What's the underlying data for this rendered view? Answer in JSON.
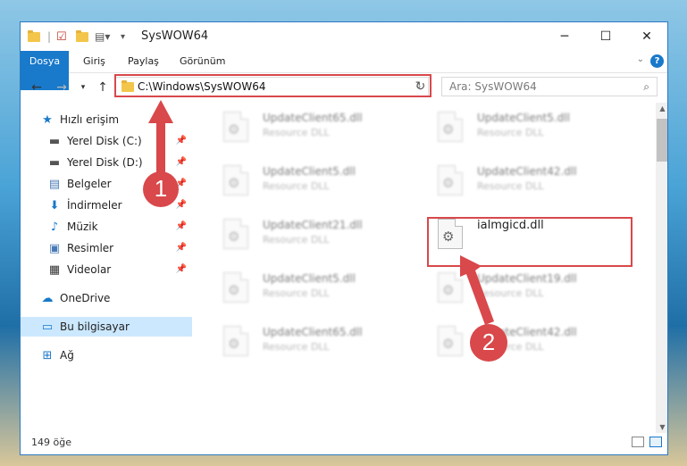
{
  "window": {
    "title": "SysWOW64",
    "controls": {
      "minimize": "─",
      "maximize": "☐",
      "close": "✕"
    }
  },
  "ribbon": {
    "tabs": [
      "Dosya",
      "Giriş",
      "Paylaş",
      "Görünüm"
    ],
    "help": "?"
  },
  "navbar": {
    "address": "C:\\Windows\\SysWOW64",
    "search_placeholder": "Ara: SysWOW64"
  },
  "sidebar": {
    "items": [
      {
        "label": "Hızlı erişim",
        "icon": "star-icon"
      },
      {
        "label": "Yerel Disk (C:)",
        "icon": "drive-icon"
      },
      {
        "label": "Yerel Disk (D:)",
        "icon": "drive-icon"
      },
      {
        "label": "Belgeler",
        "icon": "documents-icon"
      },
      {
        "label": "İndirmeler",
        "icon": "download-icon"
      },
      {
        "label": "Müzik",
        "icon": "music-icon"
      },
      {
        "label": "Resimler",
        "icon": "pictures-icon"
      },
      {
        "label": "Videolar",
        "icon": "video-icon"
      },
      {
        "label": "OneDrive",
        "icon": "cloud-icon"
      },
      {
        "label": "Bu bilgisayar",
        "icon": "computer-icon"
      },
      {
        "label": "Ağ",
        "icon": "network-icon"
      }
    ]
  },
  "files": [
    {
      "name": "UpdateClient65.dll",
      "type": "Resource DLL"
    },
    {
      "name": "UpdateClient5.dll",
      "type": "Resource DLL"
    },
    {
      "name": "UpdateClient5.dll",
      "type": "Resource DLL"
    },
    {
      "name": "UpdateClient42.dll",
      "type": "Resource DLL"
    },
    {
      "name": "UpdateClient21.dll",
      "type": "Resource DLL"
    },
    {
      "name": "ialmgicd.dll",
      "type": ""
    },
    {
      "name": "UpdateClient5.dll",
      "type": "Resource DLL"
    },
    {
      "name": "UpdateClient19.dll",
      "type": "Resource DLL"
    },
    {
      "name": "UpdateClient65.dll",
      "type": "Resource DLL"
    },
    {
      "name": "UpdateClient42.dll",
      "type": "Resource DLL"
    }
  ],
  "status": {
    "count": "149 öğe"
  },
  "callouts": [
    "1",
    "2"
  ],
  "colors": {
    "accent": "#1979ca",
    "highlight": "#d9484b",
    "selection": "#cce8ff"
  }
}
